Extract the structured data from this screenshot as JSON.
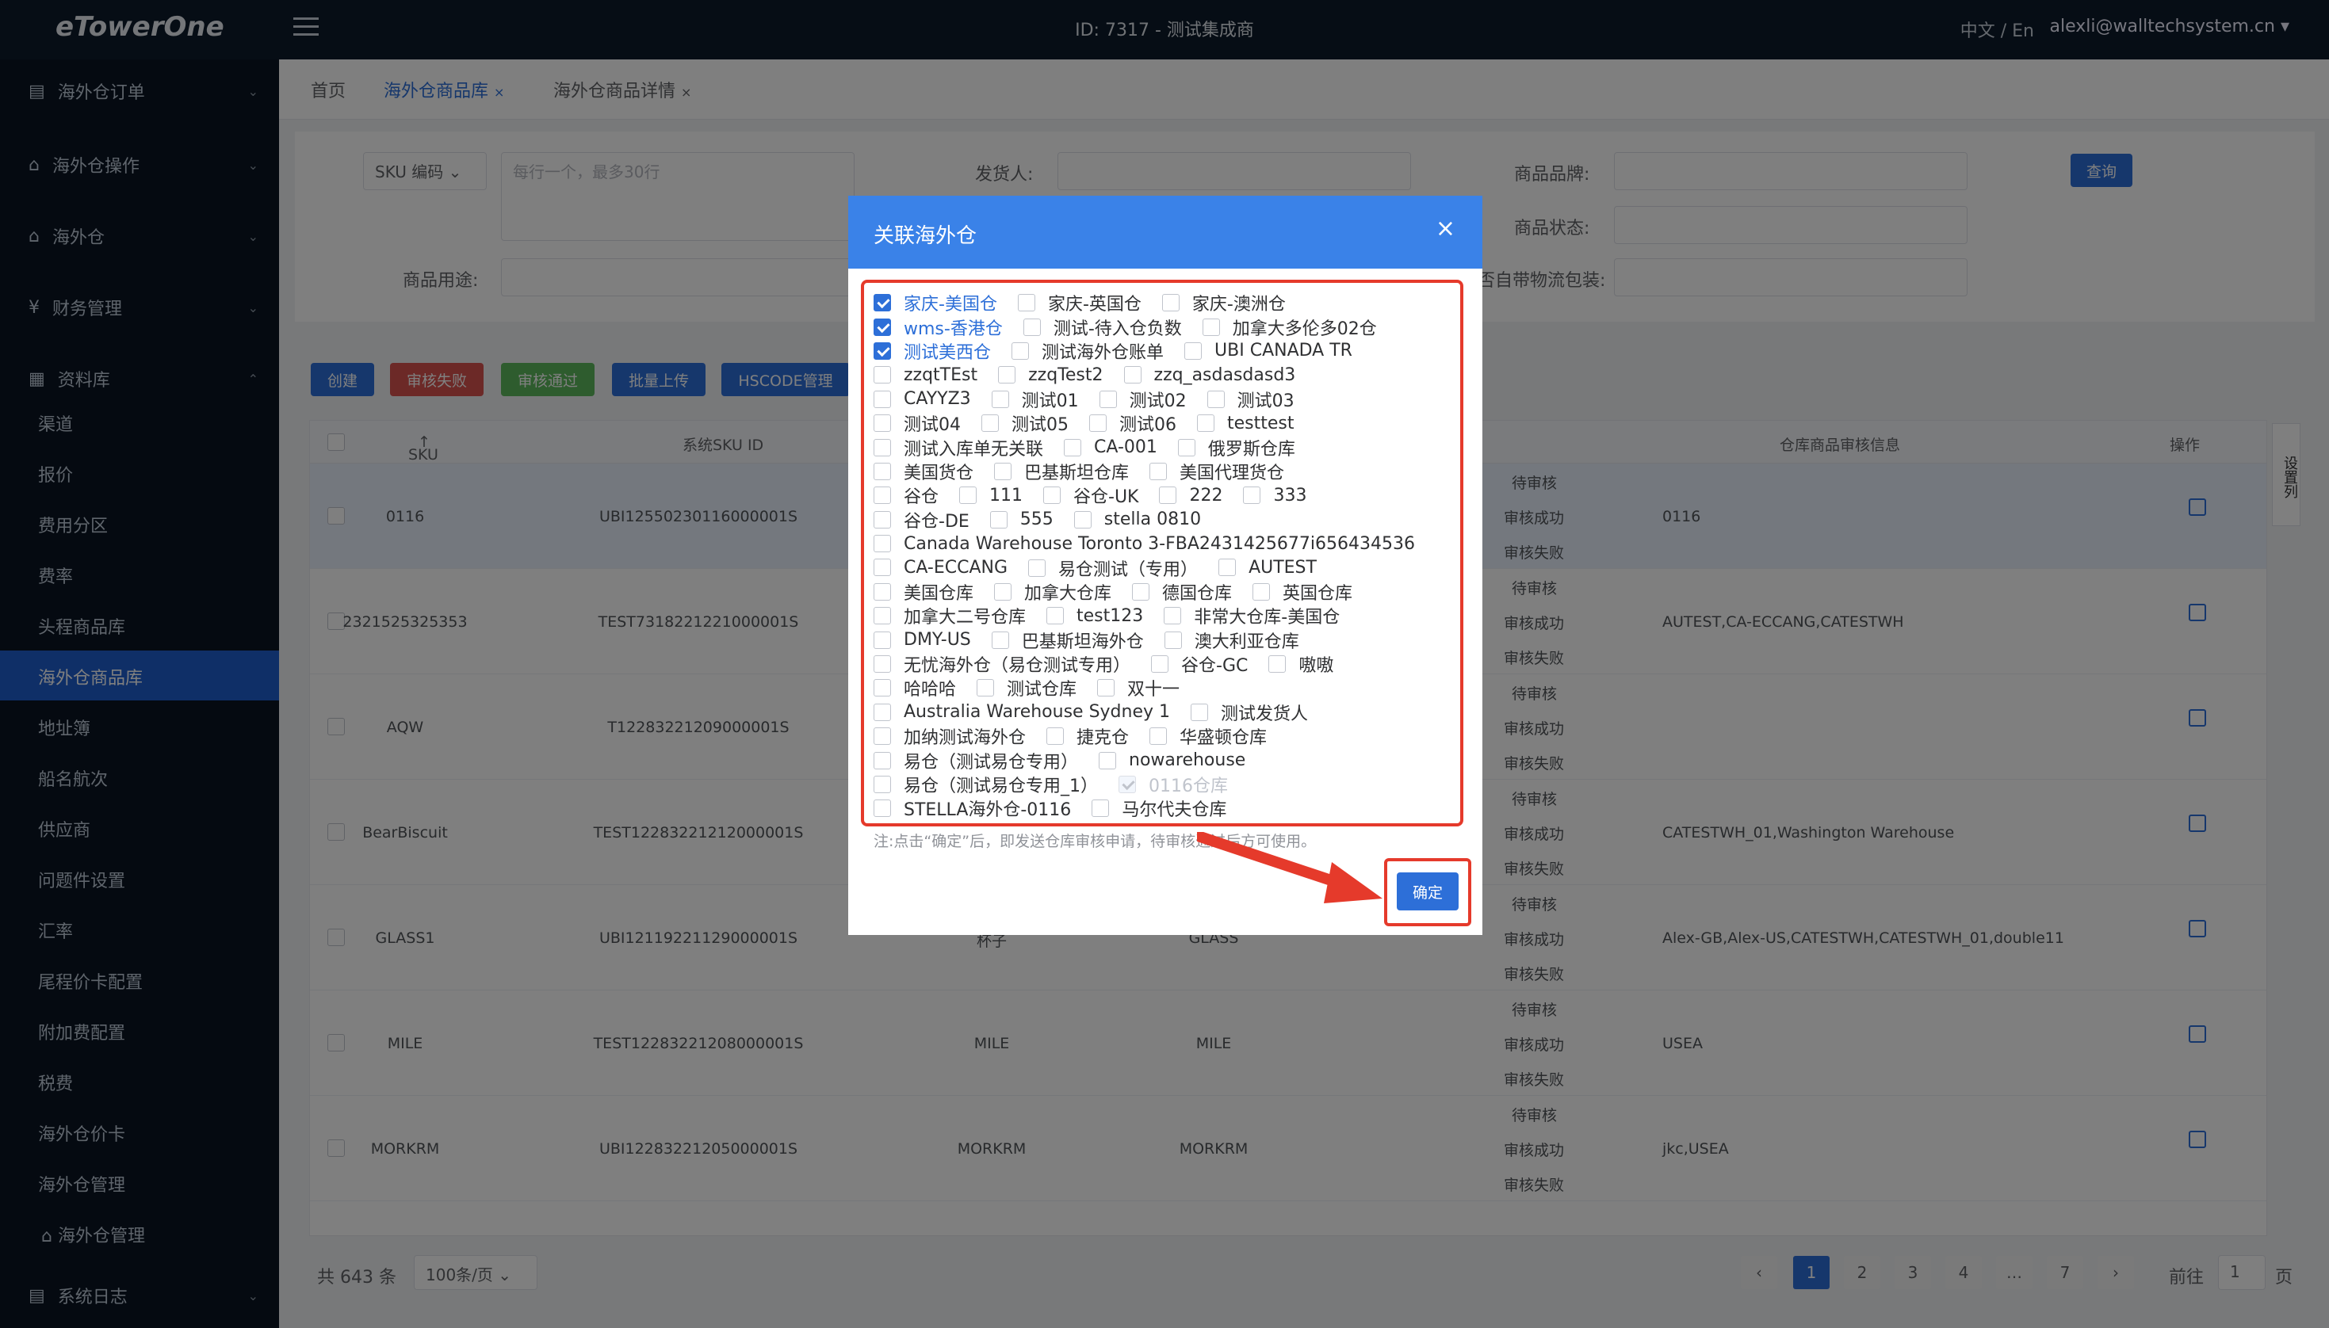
{
  "header": {
    "logo": "eTowerOne",
    "title": "ID: 7317 - 测试集成商",
    "lang": "中文 / En",
    "user": "alexli@walltechsystem.cn"
  },
  "sidebar": {
    "groups": [
      "海外仓订单",
      "海外仓操作",
      "海外仓",
      "财务管理",
      "资料库"
    ],
    "items": [
      "渠道",
      "报价",
      "费用分区",
      "费率",
      "头程商品库",
      "海外仓商品库",
      "地址簿",
      "船名航次",
      "供应商",
      "问题件设置",
      "汇率",
      "尾程价卡配置",
      "附加费配置",
      "税费",
      "海外仓价卡",
      "海外仓管理",
      "海外仓管理"
    ],
    "footer": "系统日志"
  },
  "tabs": [
    {
      "label": "首页"
    },
    {
      "label": "海外仓商品库"
    },
    {
      "label": "海外仓商品详情"
    }
  ],
  "filters": {
    "sku_select": "SKU 编码",
    "sku_placeholder": "每行一个，最多30行",
    "shipper": "发货人:",
    "brand": "商品品牌:",
    "status": "商品状态:",
    "usage": "商品用途:",
    "pack": "是否自带物流包装:",
    "search": "查询"
  },
  "actions": [
    "创建",
    "审核失败",
    "审核通过",
    "批量上传",
    "HSCODE管理"
  ],
  "table": {
    "headers": [
      "SKU 编码",
      "系统SKU ID",
      "仓库商品审核信息",
      "操作"
    ],
    "rows": [
      {
        "sku": "0116",
        "sysid": "UBI12550230116000001S",
        "name": "",
        "brand": "",
        "info": "0116"
      },
      {
        "sku": "2321525325353",
        "sysid": "TEST7318221221000001S",
        "name": "",
        "brand": "",
        "info": "AUTEST,CA-ECCANG,CATESTWH"
      },
      {
        "sku": "AQW",
        "sysid": "T12283221209000001S",
        "name": "",
        "brand": "",
        "info": ""
      },
      {
        "sku": "BearBiscuit",
        "sysid": "TEST12283221212000001S",
        "name": "",
        "brand": "",
        "info": "CATESTWH_01,Washington Warehouse"
      },
      {
        "sku": "GLASS1",
        "sysid": "UBI12119221129000001S",
        "name": "杯子",
        "brand": "GLASS",
        "info": "Alex-GB,Alex-US,CATESTWH,CATESTWH_01,double11"
      },
      {
        "sku": "MILE",
        "sysid": "TEST12283221208000001S",
        "name": "MILE",
        "brand": "MILE",
        "info": "USEA"
      },
      {
        "sku": "MORKRM",
        "sysid": "UBI12283221205000001S",
        "name": "MORKRM",
        "brand": "MORKRM",
        "info": "jkc,USEA"
      }
    ],
    "statuses": [
      "待审核",
      "审核成功",
      "审核失败"
    ],
    "set_col": "设置列"
  },
  "pagination": {
    "total": "共 643 条",
    "per_page": "100条/页",
    "pages": [
      "1",
      "2",
      "3",
      "4",
      "…",
      "7"
    ],
    "goto": "前往",
    "goto_val": "1",
    "page_unit": "页"
  },
  "dialog": {
    "title": "关联海外仓",
    "rows": [
      [
        {
          "n": "家庆-美国仓",
          "s": "checked"
        },
        {
          "n": "家庆-英国仓"
        },
        {
          "n": "家庆-澳洲仓"
        }
      ],
      [
        {
          "n": "wms-香港仓",
          "s": "checked"
        },
        {
          "n": "测试-待入仓负数"
        },
        {
          "n": "加拿大多伦多02仓"
        }
      ],
      [
        {
          "n": "测试美西仓",
          "s": "checked"
        },
        {
          "n": "测试海外仓账单"
        },
        {
          "n": "UBI CANADA TR"
        }
      ],
      [
        {
          "n": "zzqtTEst"
        },
        {
          "n": "zzqTest2"
        },
        {
          "n": "zzq_asdasdasd3"
        }
      ],
      [
        {
          "n": "CAYYZ3"
        },
        {
          "n": "测试01"
        },
        {
          "n": "测试02"
        },
        {
          "n": "测试03"
        }
      ],
      [
        {
          "n": "测试04"
        },
        {
          "n": "测试05"
        },
        {
          "n": "测试06"
        },
        {
          "n": "testtest"
        }
      ],
      [
        {
          "n": "测试入库单无关联"
        },
        {
          "n": "CA-001"
        },
        {
          "n": "俄罗斯仓库"
        }
      ],
      [
        {
          "n": "美国货仓"
        },
        {
          "n": "巴基斯坦仓库"
        },
        {
          "n": "美国代理货仓"
        }
      ],
      [
        {
          "n": "谷仓"
        },
        {
          "n": "111"
        },
        {
          "n": "谷仓-UK"
        },
        {
          "n": "222"
        },
        {
          "n": "333"
        }
      ],
      [
        {
          "n": "谷仓-DE"
        },
        {
          "n": "555"
        },
        {
          "n": "stella 0810"
        }
      ],
      [
        {
          "n": "Canada Warehouse Toronto 3-FBA2431425677i656434536"
        }
      ],
      [
        {
          "n": "CA-ECCANG"
        },
        {
          "n": "易仓测试（专用）"
        },
        {
          "n": "AUTEST"
        }
      ],
      [
        {
          "n": "美国仓库"
        },
        {
          "n": "加拿大仓库"
        },
        {
          "n": "德国仓库"
        },
        {
          "n": "英国仓库"
        }
      ],
      [
        {
          "n": "加拿大二号仓库"
        },
        {
          "n": "test123"
        },
        {
          "n": "非常大仓库-美国仓"
        }
      ],
      [
        {
          "n": "DMY-US"
        },
        {
          "n": "巴基斯坦海外仓"
        },
        {
          "n": "澳大利亚仓库"
        }
      ],
      [
        {
          "n": "无忧海外仓（易仓测试专用）"
        },
        {
          "n": "谷仓-GC"
        },
        {
          "n": "嗷嗷"
        }
      ],
      [
        {
          "n": "哈哈哈"
        },
        {
          "n": "测试仓库"
        },
        {
          "n": "双十一"
        }
      ],
      [
        {
          "n": "Australia Warehouse Sydney 1"
        },
        {
          "n": "测试发货人"
        }
      ],
      [
        {
          "n": "加纳测试海外仓"
        },
        {
          "n": "捷克仓"
        },
        {
          "n": "华盛顿仓库"
        }
      ],
      [
        {
          "n": "易仓（测试易仓专用）"
        },
        {
          "n": "nowarehouse"
        }
      ],
      [
        {
          "n": "易仓（测试易仓专用_1）"
        },
        {
          "n": "0116仓库",
          "s": "disabled"
        }
      ],
      [
        {
          "n": "STELLA海外仓-0116"
        },
        {
          "n": "马尔代夫仓库"
        }
      ]
    ],
    "note": "注:点击“确定”后，即发送仓库审核申请，待审核通过后方可使用。",
    "confirm": "确定"
  },
  "colors": {
    "primary": "#2d6fd8",
    "highlight": "#e53a2b",
    "sidebar": "#0a1422"
  }
}
